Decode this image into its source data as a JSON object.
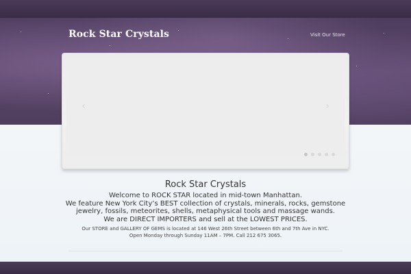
{
  "header": {
    "brand": "Rock Star Crystals",
    "nav_link": "Visit Our Store"
  },
  "slider": {
    "prev_icon": "chevron-left-icon",
    "next_icon": "chevron-right-icon",
    "dot_count": 5
  },
  "main": {
    "title": "Rock Star Crystals",
    "lines": [
      "Welcome to ROCK STAR located in mid-town Manhattan.",
      "We feature New York City’s BEST collection of crystals, minerals, rocks, gemstone",
      "jewelry, fossils, meteorites, shells, metaphysical tools and massage wands.",
      "We are DIRECT IMPORTERS and sell at the LOWEST PRICES."
    ],
    "small_lines": [
      "Our STORE and GALLERY OF GEMS is located at 146 West 26th Street between 6th and 7th Ave in NYC.",
      "Open Monday through Sunday 11AM – 7PM. Call 212 675 3065."
    ]
  },
  "colors": {
    "hero": "#5b4769",
    "strip": "#3f3050",
    "text": "#333333"
  }
}
